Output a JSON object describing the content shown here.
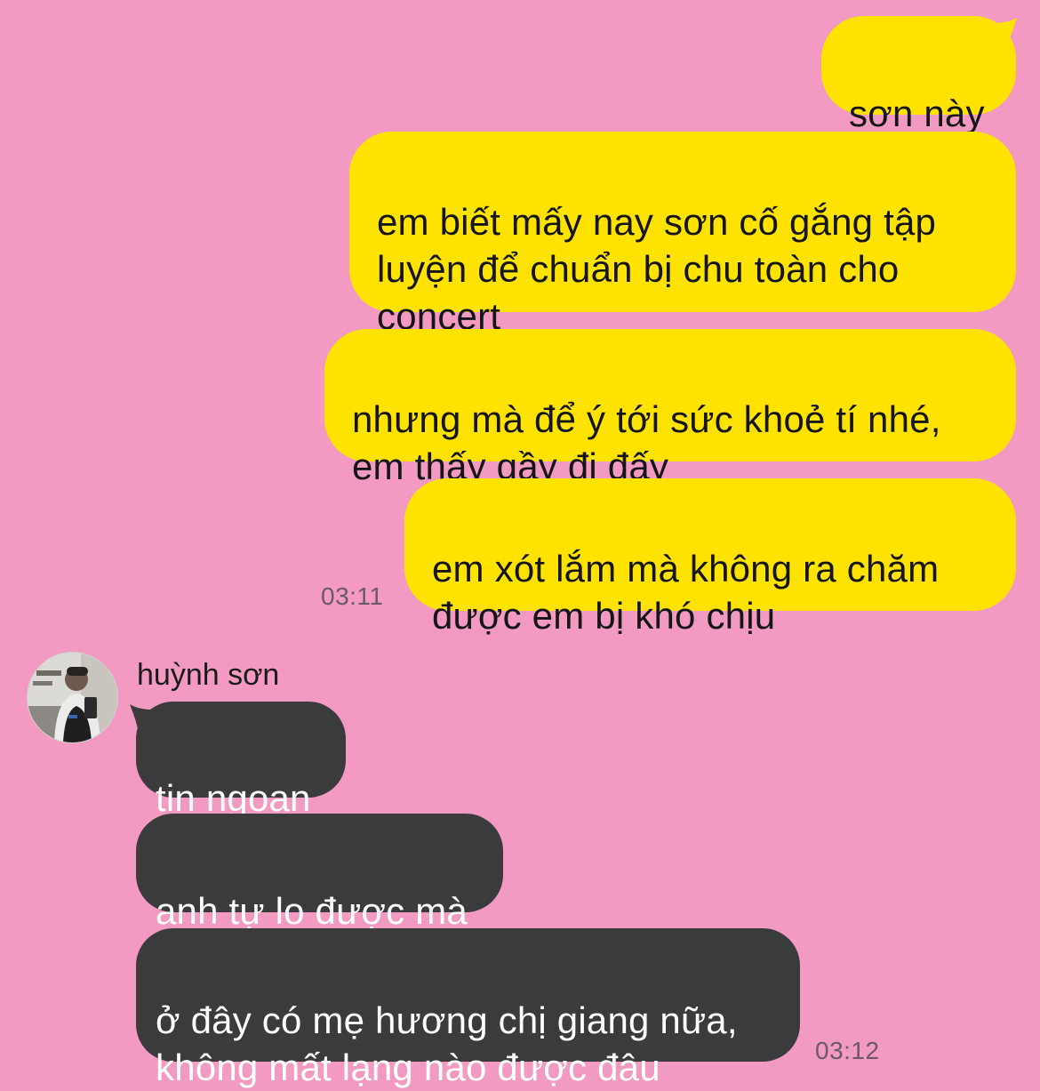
{
  "conversation": {
    "outgoing": [
      {
        "text": "sơn này"
      },
      {
        "text": "em biết mấy nay sơn cố gắng tập\nluyện để chuẩn bị chu toàn cho\nconcert"
      },
      {
        "text": "nhưng mà để ý tới sức khoẻ tí nhé,\nem thấy gầy đi đấy"
      },
      {
        "text": "em xót lắm mà không ra chăm\nđược em bị khó chịu"
      }
    ],
    "outgoing_time": "03:11",
    "contact": {
      "name": "huỳnh sơn",
      "avatar_icon": "profile-photo"
    },
    "incoming": [
      {
        "text": "tin ngoan"
      },
      {
        "text": "anh tự lo được mà"
      },
      {
        "text": "ở đây có mẹ hương chị giang nữa,\nkhông mất lạng nào được đâu"
      }
    ],
    "incoming_time": "03:12"
  },
  "colors": {
    "background": "#f29ac2",
    "sent_bubble": "#ffe300",
    "received_bubble": "#3b3b3d"
  }
}
